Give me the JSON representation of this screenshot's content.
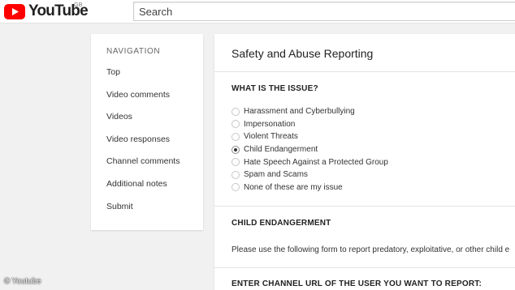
{
  "header": {
    "logo_text": "YouTube",
    "logo_region": "GB",
    "search_placeholder": "Search"
  },
  "navigation": {
    "title": "NAVIGATION",
    "items": [
      {
        "label": "Top"
      },
      {
        "label": "Video comments"
      },
      {
        "label": "Videos"
      },
      {
        "label": "Video responses"
      },
      {
        "label": "Channel comments"
      },
      {
        "label": "Additional notes"
      },
      {
        "label": "Submit"
      }
    ]
  },
  "form": {
    "title": "Safety and Abuse Reporting",
    "issue_heading": "WHAT IS THE ISSUE?",
    "options": [
      {
        "label": "Harassment and Cyberbullying",
        "selected": false
      },
      {
        "label": "Impersonation",
        "selected": false
      },
      {
        "label": "Violent Threats",
        "selected": false
      },
      {
        "label": "Child Endangerment",
        "selected": true
      },
      {
        "label": "Hate Speech Against a Protected Group",
        "selected": false
      },
      {
        "label": "Spam and Scams",
        "selected": false
      },
      {
        "label": "None of these are my issue",
        "selected": false
      }
    ],
    "child_heading": "CHILD ENDANGERMENT",
    "child_text": "Please use the following form to report predatory, exploitative, or other child e",
    "channel_heading": "ENTER CHANNEL URL OF THE USER YOU WANT TO REPORT:"
  },
  "caption": {
    "symbol": "©",
    "text": "Youtube"
  },
  "colors": {
    "brand_red": "#ff0000",
    "background": "#f1f1f1",
    "card": "#ffffff"
  }
}
